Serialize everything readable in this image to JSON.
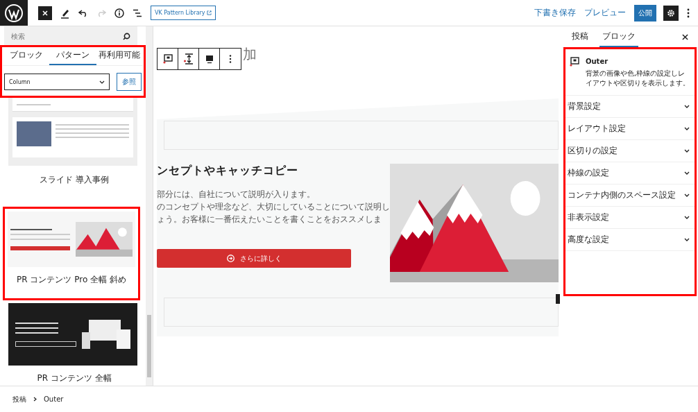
{
  "toolbar": {
    "pattern_library_button": "VK Pattern Library",
    "redo_disabled": true,
    "save_draft": "下書き保存",
    "preview": "プレビュー",
    "publish": "公開",
    "settings_pressed": true
  },
  "inserter": {
    "search": {
      "placeholder": "検索"
    },
    "highlighted": true,
    "tabs": [
      {
        "label": "ブロック",
        "selected": false
      },
      {
        "label": "パターン",
        "selected": true
      },
      {
        "label": "再利用可能",
        "selected": false
      }
    ],
    "category_select": {
      "value": "Column"
    },
    "explore_button": "参照",
    "patterns": [
      {
        "kind": "slide",
        "label": "スライド 導入事例",
        "highlighted": false
      },
      {
        "kind": "pr-light",
        "label": "PR コンテンツ Pro 全幅 斜め",
        "highlighted": true
      },
      {
        "kind": "pr-dark",
        "label": "PR コンテンツ 全幅",
        "highlighted": false
      }
    ]
  },
  "canvas": {
    "title_visible": "加",
    "heading": "ンセプトやキャッチコピー",
    "paragraph_lines": [
      "部分には、自社について説明が入ります。",
      "のコンセプトや理念など、大切にしていることについて説明し",
      "ょう。お客様に一番伝えたいことを書くことをおススメしま"
    ],
    "button": "さらに詳しく"
  },
  "sidebar": {
    "tabs": [
      {
        "label": "投稿",
        "selected": false
      },
      {
        "label": "ブロック",
        "selected": true
      }
    ],
    "highlighted": true,
    "block": {
      "name": "Outer",
      "description": "背景の画像や色,枠線の設定しレイアウトや区切りを表示します。"
    },
    "panels": [
      {
        "title": "背景設定",
        "expanded": false
      },
      {
        "title": "レイアウト設定",
        "expanded": false
      },
      {
        "title": "区切りの設定",
        "expanded": false
      },
      {
        "title": "枠線の設定",
        "expanded": false
      },
      {
        "title": "コンテナ内側のスペース設定",
        "expanded": false
      },
      {
        "title": "非表示設定",
        "expanded": false
      },
      {
        "title": "高度な設定",
        "expanded": false
      }
    ]
  },
  "breadcrumb": [
    "投稿",
    "Outer"
  ]
}
